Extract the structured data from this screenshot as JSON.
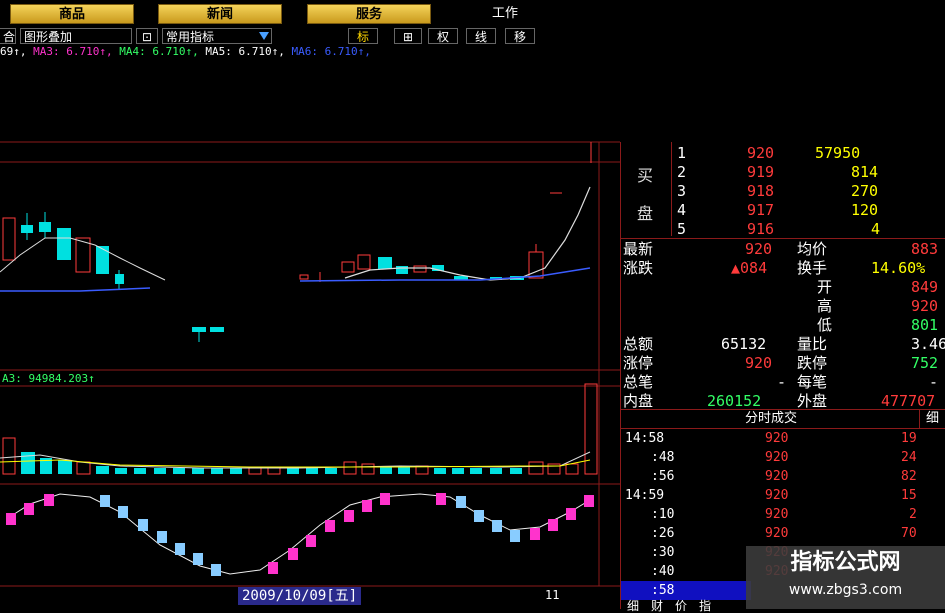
{
  "top_buttons": [
    "商品",
    "新闻",
    "服务",
    "工作"
  ],
  "toolbar": {
    "item0": "合",
    "overlay": "图形叠加",
    "lock_glyph": "⊡",
    "indicators": "常用指标",
    "biao": "标",
    "grid_glyph": "⊞",
    "quan": "权",
    "xian": "线",
    "yi": "移"
  },
  "ma_line": {
    "prefix": "69↑,",
    "ma3": "MA3: 6.710↑,",
    "ma4": "MA4: 6.710↑,",
    "ma5": "MA5: 6.710↑,",
    "ma6": "MA6: 6.710↑,"
  },
  "vol_label": "A3: 94984.203↑",
  "date_label": "2009/10/09[五]",
  "date_right": "11",
  "order_book": {
    "buy_label_1": "买",
    "buy_label_2": "盘",
    "rows": [
      {
        "level": "1",
        "price": "920",
        "volume": "57950"
      },
      {
        "level": "2",
        "price": "919",
        "volume": "814"
      },
      {
        "level": "3",
        "price": "918",
        "volume": "270"
      },
      {
        "level": "4",
        "price": "917",
        "volume": "120"
      },
      {
        "level": "5",
        "price": "916",
        "volume": "4"
      }
    ]
  },
  "quote": {
    "latest_label": "最新",
    "latest_value": "920",
    "avg_label": "均价",
    "avg_value": "883",
    "change_label": "涨跌",
    "change_value": "▲084",
    "turnover_label": "换手",
    "turnover_value": "14.60%",
    "open_label": "开",
    "open_value": "849",
    "high_label": "高",
    "high_value": "920",
    "low_label": "低",
    "low_value": "801",
    "total_amt_label": "总额",
    "total_amt_value": "65132",
    "ratio_label": "量比",
    "ratio_value": "3.46",
    "limit_up_label": "涨停",
    "limit_up_value": "920",
    "limit_down_label": "跌停",
    "limit_down_value": "752",
    "total_ticks_label": "总笔",
    "total_ticks_value": "-",
    "per_tick_label": "每笔",
    "per_tick_value": "-",
    "inner_label": "内盘",
    "inner_value": "260152",
    "outer_label": "外盘",
    "outer_value": "477707"
  },
  "ticks_header": {
    "title": "分时成交",
    "detail": "细"
  },
  "ticks": [
    {
      "time": "14:58",
      "price": "920",
      "vol": "19"
    },
    {
      "time": ":48",
      "price": "920",
      "vol": "24"
    },
    {
      "time": ":56",
      "price": "920",
      "vol": "82"
    },
    {
      "time": "14:59",
      "price": "920",
      "vol": "15"
    },
    {
      "time": ":10",
      "price": "920",
      "vol": "2"
    },
    {
      "time": ":26",
      "price": "920",
      "vol": "70"
    },
    {
      "time": ":30",
      "price": "920",
      "vol": ""
    },
    {
      "time": ":40",
      "price": "920",
      "vol": ""
    },
    {
      "time": ":58",
      "price": "",
      "vol": ""
    }
  ],
  "bottom_tabs": [
    "细",
    "财",
    "价",
    "指"
  ],
  "watermark": {
    "line1": "指标公式网",
    "line2": "www.zbgs3.com"
  },
  "colors": {
    "up": "#ff3b3b",
    "down": "#00e0e0",
    "border": "#8b1a1a",
    "gold": "#e8b832",
    "magenta": "#ff33cc",
    "lightblue": "#88ccff"
  }
}
